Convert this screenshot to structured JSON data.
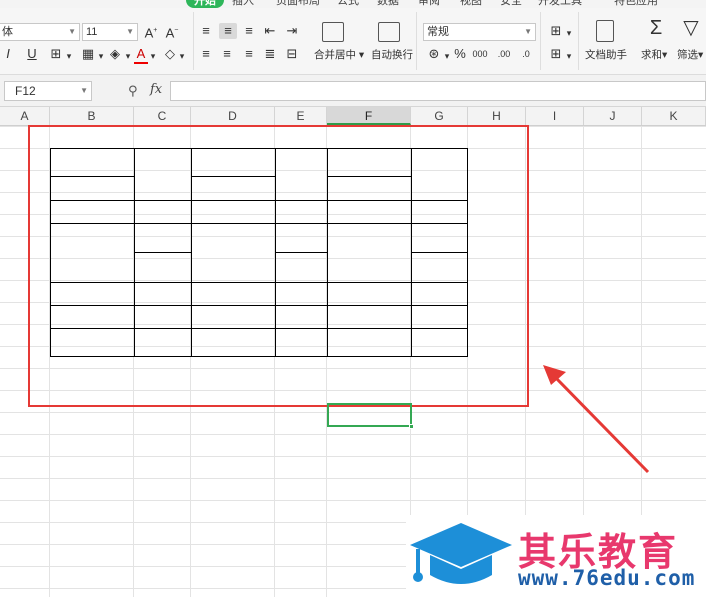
{
  "ribbon_tabs": {
    "items": [
      {
        "label": "开始",
        "active": true
      },
      {
        "label": "插入"
      },
      {
        "label": "页面布局"
      },
      {
        "label": "公式"
      },
      {
        "label": "数据"
      },
      {
        "label": "审阅"
      },
      {
        "label": "视图"
      },
      {
        "label": "安全"
      },
      {
        "label": "开发工具"
      },
      {
        "label": "特色应用"
      }
    ]
  },
  "ribbon": {
    "font_name": "体",
    "font_size": "11",
    "number_format": "常规",
    "merge_center_label": "合并居中",
    "wrap_text_label": "自动换行",
    "doc_helper_label": "文档助手",
    "sum_label": "求和",
    "filter_label": "筛选"
  },
  "formula_bar": {
    "cell_ref": "F12",
    "fx_label": "fx",
    "value": ""
  },
  "columns": [
    {
      "label": "A"
    },
    {
      "label": "B"
    },
    {
      "label": "C"
    },
    {
      "label": "D"
    },
    {
      "label": "E"
    },
    {
      "label": "F",
      "active": true
    },
    {
      "label": "G"
    },
    {
      "label": "H"
    },
    {
      "label": "I"
    },
    {
      "label": "J"
    },
    {
      "label": "K"
    }
  ],
  "watermark": {
    "brand": "其乐教育",
    "url": "www.76edu.com"
  },
  "colors": {
    "accent_green": "#2eb65a",
    "highlight_red": "#e53935",
    "selection_green": "#34a853",
    "brand_pink": "#e8386d",
    "brand_blue": "#1f5fa8",
    "arrow_red": "#e53935"
  }
}
